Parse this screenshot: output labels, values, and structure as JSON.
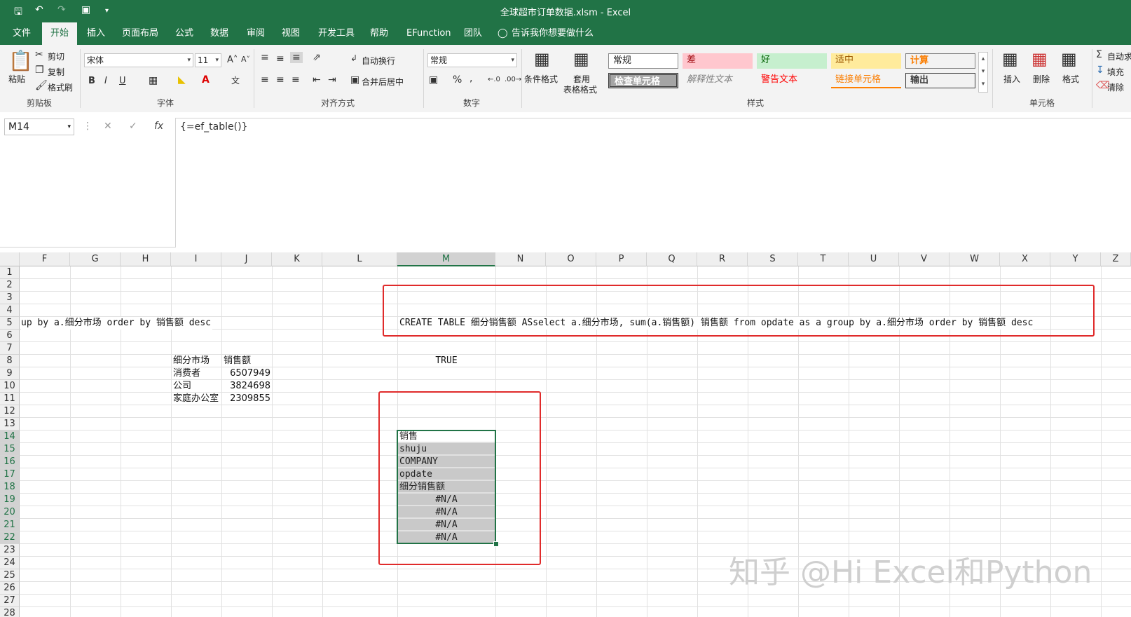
{
  "title": "全球超市订单数据.xlsm  -  Excel",
  "tabs": [
    "文件",
    "开始",
    "插入",
    "页面布局",
    "公式",
    "数据",
    "审阅",
    "视图",
    "开发工具",
    "帮助",
    "EFunction",
    "团队",
    "告诉我你想要做什么"
  ],
  "ribbon": {
    "clipboard": {
      "paste": "粘贴",
      "cut": "剪切",
      "copy": "复制",
      "format_painter": "格式刷",
      "label": "剪贴板"
    },
    "font": {
      "name": "宋体",
      "size": "11",
      "label": "字体"
    },
    "alignment": {
      "wrap": "自动换行",
      "merge": "合并后居中",
      "label": "对齐方式"
    },
    "number": {
      "format": "常规",
      "label": "数字"
    },
    "styles": {
      "conditional": "条件格式",
      "table_format_1": "套用",
      "table_format_2": "表格格式",
      "label": "样式",
      "cells": [
        "常规",
        "差",
        "好",
        "适中",
        "计算",
        "检查单元格",
        "解释性文本",
        "警告文本",
        "链接单元格",
        "输出"
      ]
    },
    "cells": {
      "insert": "插入",
      "delete": "删除",
      "format": "格式",
      "label": "单元格"
    },
    "editing": {
      "autosum": "自动求",
      "fill": "填充",
      "clear": "清除"
    }
  },
  "formula_bar": {
    "name_box": "M14",
    "formula": "{=ef_table()}"
  },
  "grid": {
    "columns": [
      "F",
      "G",
      "H",
      "I",
      "J",
      "K",
      "L",
      "M",
      "N",
      "O",
      "P",
      "Q",
      "R",
      "S",
      "T",
      "U",
      "V",
      "W",
      "X",
      "Y",
      "Z"
    ],
    "rows": [
      "1",
      "2",
      "3",
      "4",
      "5",
      "6",
      "7",
      "8",
      "9",
      "10",
      "11",
      "12",
      "13",
      "14",
      "15",
      "16",
      "17",
      "18",
      "19",
      "20",
      "21",
      "22",
      "23",
      "24",
      "25",
      "26",
      "27",
      "28"
    ],
    "row5_left": "up by a.细分市场 order by 销售额 desc",
    "row5_sql": "CREATE TABLE 细分销售额 ASselect a.细分市场, sum(a.销售额) 销售额  from opdate as a group by a.细分市场 order by 销售额 desc",
    "m8": "TRUE",
    "table": {
      "headers": [
        "细分市场",
        "销售额"
      ],
      "rows": [
        [
          "消费者",
          "6507949"
        ],
        [
          "公司",
          "3824698"
        ],
        [
          "家庭办公室",
          "2309855"
        ]
      ]
    },
    "m_list": [
      "销售",
      "shuju",
      "COMPANY",
      "opdate",
      "细分销售额",
      "#N/A",
      "#N/A",
      "#N/A",
      "#N/A"
    ]
  },
  "watermark": "知乎 @Hi Excel和Python"
}
